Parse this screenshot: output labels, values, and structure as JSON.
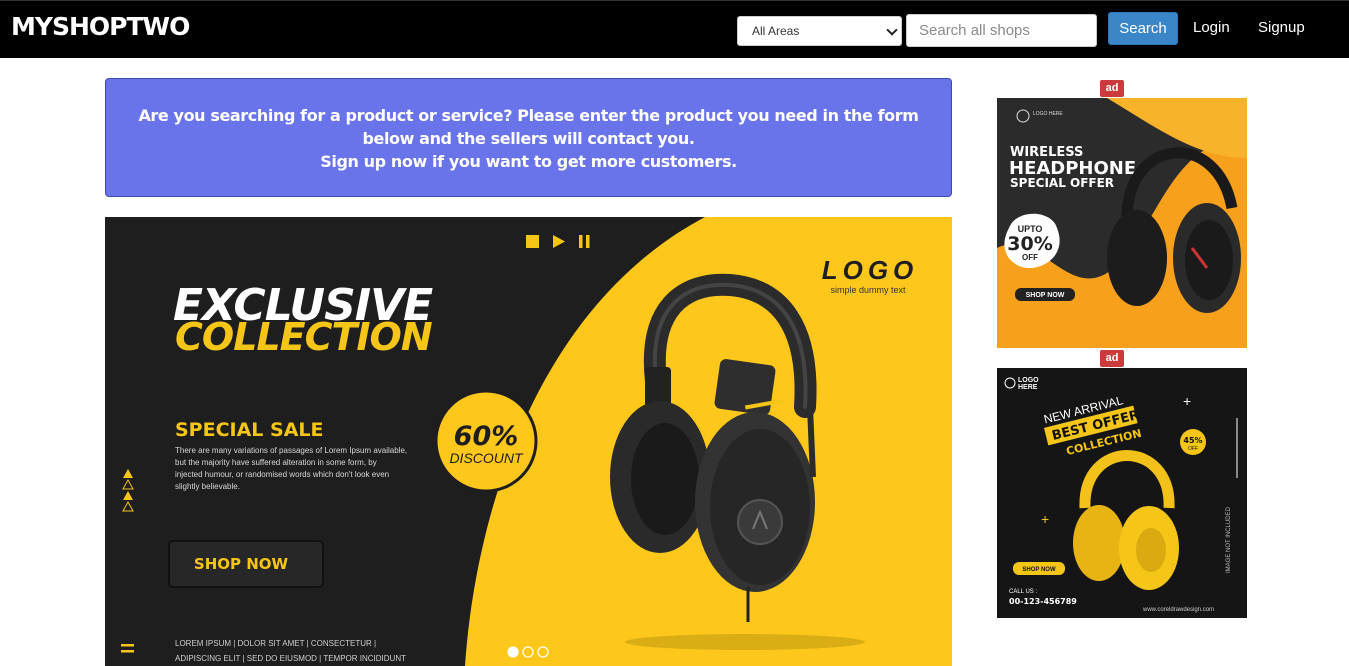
{
  "header": {
    "brand": "MYSHOPTWO",
    "area_select": "All Areas",
    "search_placeholder": "Search all shops",
    "search_label": "Search",
    "login_label": "Login",
    "signup_label": "Signup"
  },
  "notice": {
    "line1": "Are you searching for a product or service? Please enter the product you need in the form below and the sellers will contact you.",
    "line2": "Sign up now if you want to get more customers."
  },
  "banner": {
    "title1": "EXCLUSIVE",
    "title2": "COLLECTION",
    "logo": "LOGO",
    "logo_sub": "simple dummy text",
    "sale_title": "SPECIAL SALE",
    "sale_text1": "There are many variations of passages of Lorem Ipsum available,",
    "sale_text2": "but the majority have suffered alteration in some form, by",
    "sale_text3": "injected humour, or randomised words which don't look even",
    "sale_text4": "slightly believable.",
    "discount_value": "60%",
    "discount_label": "DISCOUNT",
    "shop_now": "SHOP NOW",
    "footer1": "LOREM IPSUM | DOLOR SIT AMET | CONSECTETUR |",
    "footer2": "ADIPISCING ELIT | SED DO EIUSMOD | TEMPOR INCIDIDUNT",
    "active_slide": 1,
    "slide_count": 3
  },
  "ads": {
    "badge": "ad",
    "ad1": {
      "logo": "LOGO HERE",
      "line1": "WIRELESS",
      "line2": "HEADPHONE",
      "line3": "SPECIAL OFFER",
      "upto": "UPTO",
      "percent": "30%",
      "off": "OFF",
      "cta": "SHOP NOW"
    },
    "ad2": {
      "logo1": "LOGO",
      "logo2": "HERE",
      "line1": "NEW ARRIVAL",
      "line2": "BEST OFFER",
      "line3": "COLLECTION",
      "percent": "45%",
      "off": "OFF",
      "cta": "SHOP NOW",
      "call": "CALL US :",
      "phone": "00-123-456789",
      "site": "www.coreldrawdesign.com",
      "vertical": "IMAGE NOT INCLUDED"
    }
  },
  "colors": {
    "navbar": "#000000",
    "notice_bg": "#6a74ea",
    "search_btn": "#3a86c8",
    "banner_yellow": "#fdc81b",
    "banner_dark": "#1e1e1e",
    "ad_badge": "#cc3b3b"
  }
}
